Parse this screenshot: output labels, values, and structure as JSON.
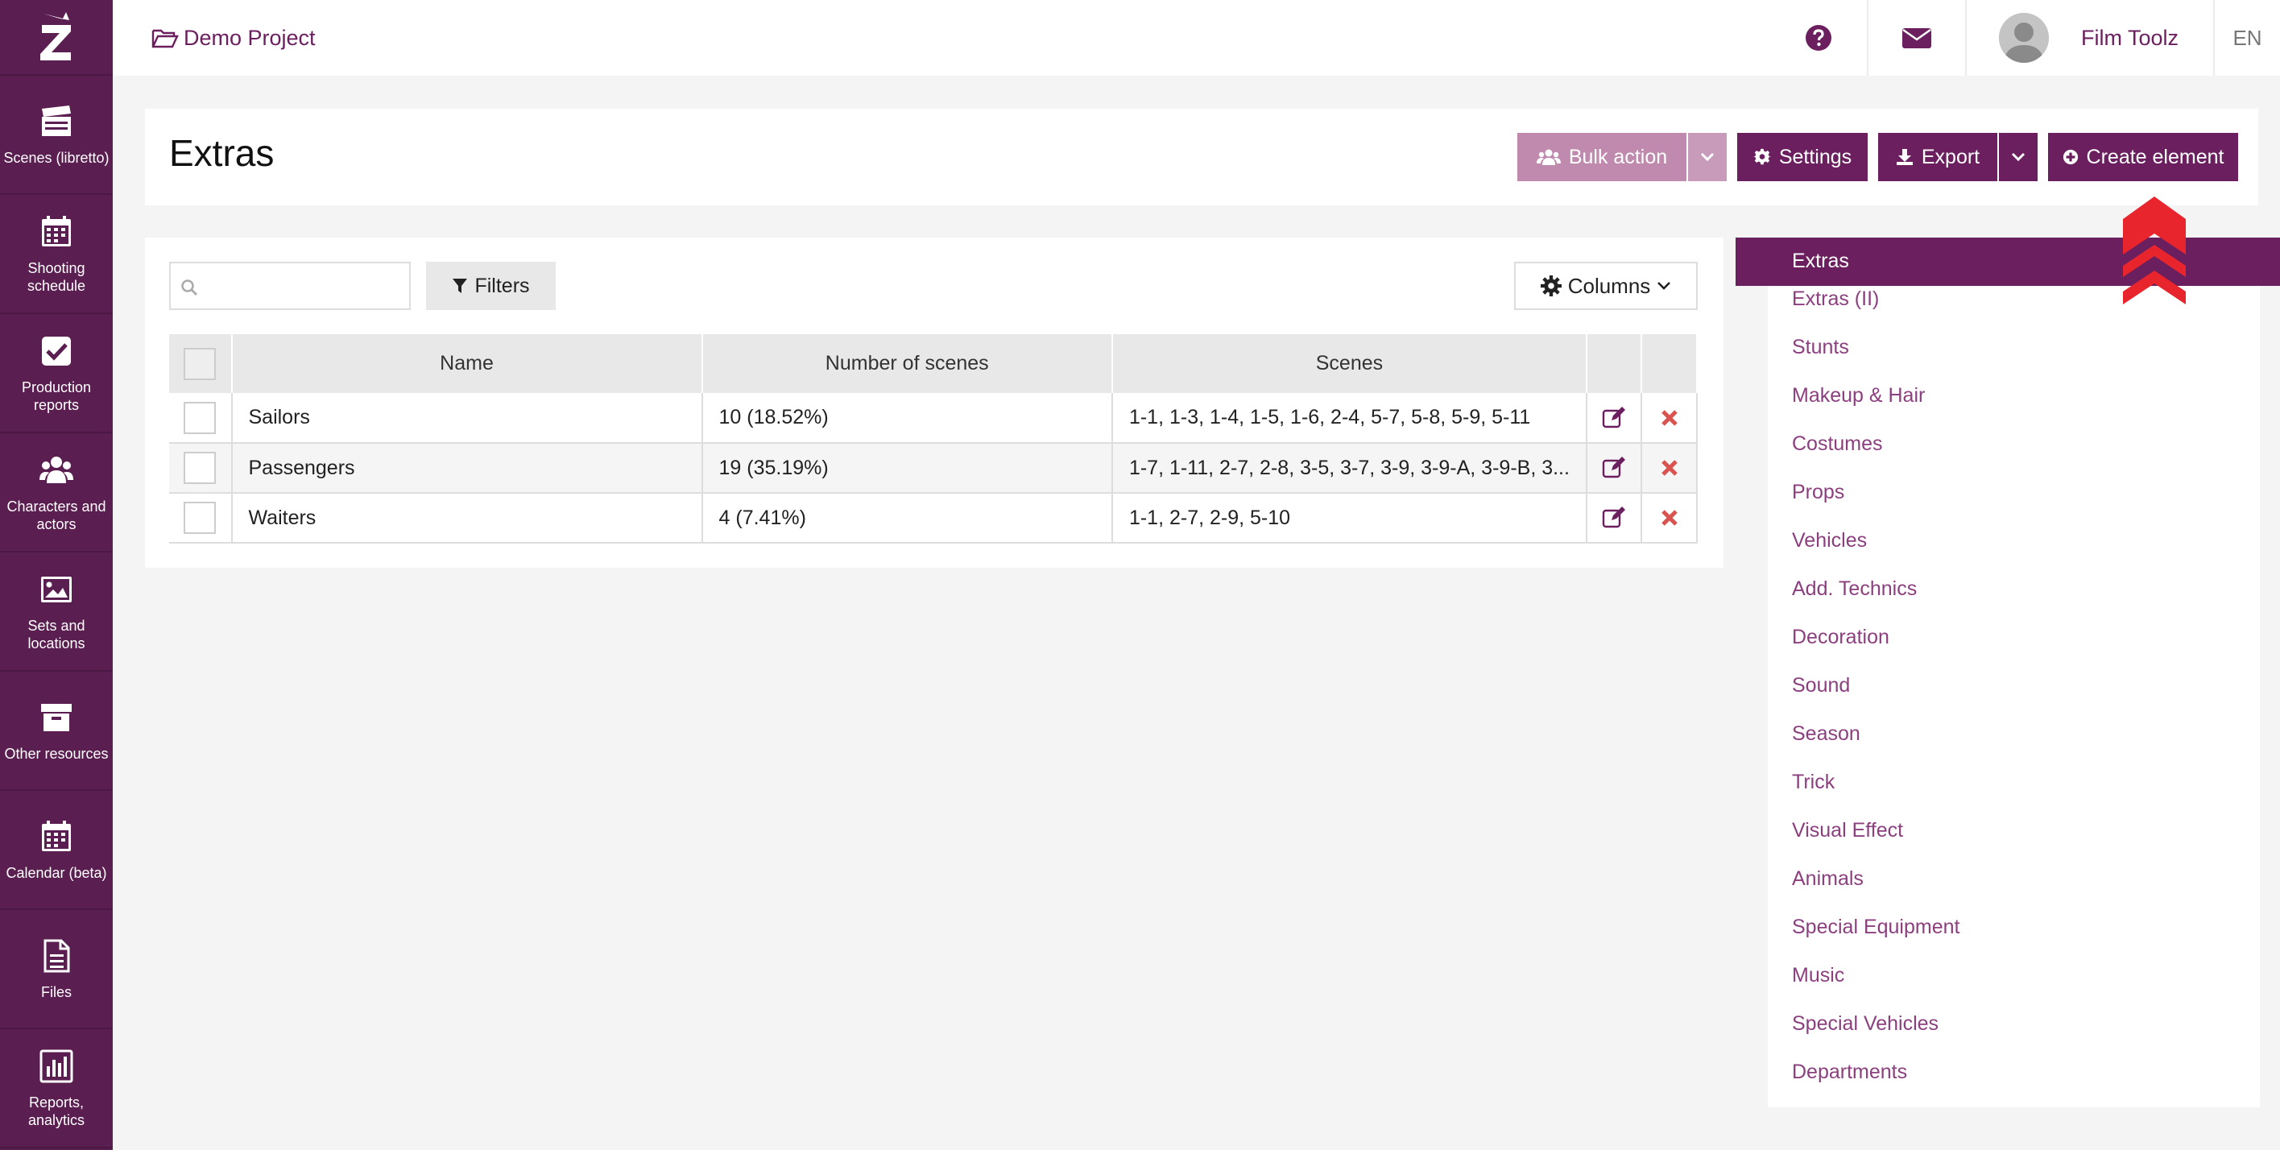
{
  "sidebar": {
    "items": [
      {
        "label": "Scenes (libretto)",
        "icon": "clapperboard-icon"
      },
      {
        "label": "Shooting schedule",
        "icon": "calendar-icon"
      },
      {
        "label": "Production reports",
        "icon": "checkbox-icon"
      },
      {
        "label": "Characters and actors",
        "icon": "users-icon"
      },
      {
        "label": "Sets and locations",
        "icon": "image-icon"
      },
      {
        "label": "Other resources",
        "icon": "archive-box-icon"
      },
      {
        "label": "Calendar (beta)",
        "icon": "calendar-icon"
      },
      {
        "label": "Files",
        "icon": "file-icon"
      },
      {
        "label": "Reports, analytics",
        "icon": "bar-chart-icon"
      }
    ]
  },
  "topbar": {
    "project_name": "Demo Project",
    "user_name": "Film Toolz",
    "language": "EN"
  },
  "header": {
    "title": "Extras",
    "bulk_action_label": "Bulk action",
    "settings_label": "Settings",
    "export_label": "Export",
    "create_label": "Create element"
  },
  "toolbar": {
    "search_placeholder": "",
    "filters_label": "Filters",
    "columns_label": "Columns"
  },
  "table": {
    "columns": [
      "Name",
      "Number of scenes",
      "Scenes"
    ],
    "rows": [
      {
        "name": "Sailors",
        "count": "10 (18.52%)",
        "scenes": "1-1, 1-3, 1-4, 1-5, 1-6, 2-4, 5-7, 5-8, 5-9, 5-11"
      },
      {
        "name": "Passengers",
        "count": "19 (35.19%)",
        "scenes": "1-7, 1-11, 2-7, 2-8, 3-5, 3-7, 3-9, 3-9-A, 3-9-B, 3..."
      },
      {
        "name": "Waiters",
        "count": "4 (7.41%)",
        "scenes": "1-1, 2-7, 2-9, 5-10"
      }
    ]
  },
  "categories": {
    "active": "Extras",
    "items": [
      "Extras (II)",
      "Stunts",
      "Makeup & Hair",
      "Costumes",
      "Props",
      "Vehicles",
      "Add. Technics",
      "Decoration",
      "Sound",
      "Season",
      "Trick",
      "Visual Effect",
      "Animals",
      "Special Equipment",
      "Music",
      "Special Vehicles",
      "Departments"
    ]
  },
  "colors": {
    "brand": "#6b1f5f",
    "sidebar": "#5a1e50",
    "link": "#8c3f7e",
    "delete": "#d9534f",
    "annotation_arrow": "#e8252c"
  }
}
